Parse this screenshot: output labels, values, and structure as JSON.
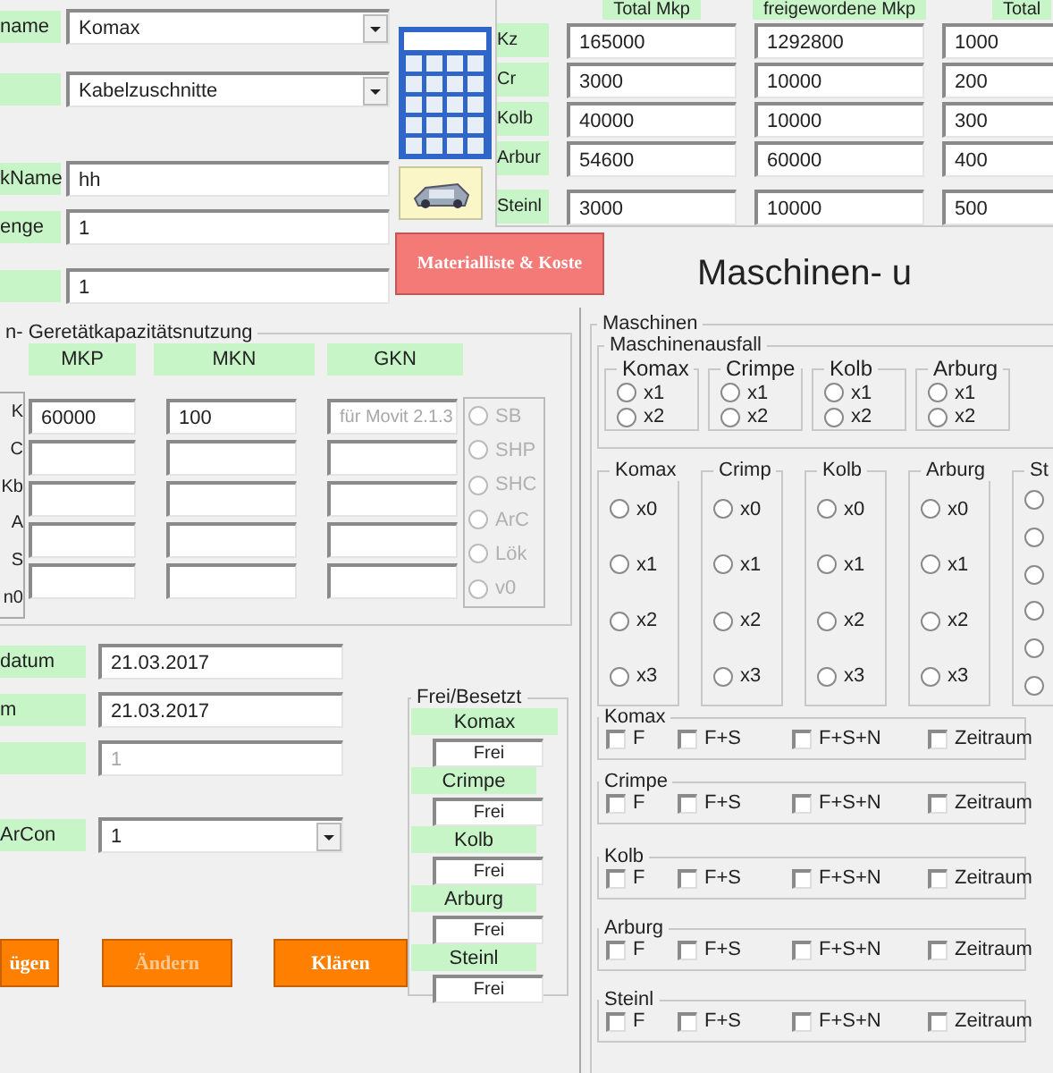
{
  "top_form": [
    {
      "label": "name",
      "kind": "combo",
      "value": "Komax"
    },
    {
      "kind": "combo",
      "value": "Kabelzuschnitte"
    },
    {
      "label": "kName",
      "kind": "text",
      "value": "hh"
    },
    {
      "label": "enge",
      "kind": "text",
      "value": "1"
    },
    {
      "kind": "text",
      "value": "1"
    }
  ],
  "capacity": {
    "headers": [
      "Total Mkp",
      "freigewordene Mkp",
      "Total"
    ],
    "rows": [
      {
        "label": "Kz",
        "values": [
          "165000",
          "1292800",
          "1000"
        ]
      },
      {
        "label": "Cr",
        "values": [
          "3000",
          "10000",
          "200"
        ]
      },
      {
        "label": "Kolb",
        "values": [
          "40000",
          "10000",
          "300"
        ]
      },
      {
        "label": "Arbur",
        "values": [
          "54600",
          "60000",
          "400"
        ]
      },
      {
        "label": "Steinl",
        "values": [
          "3000",
          "10000",
          "500"
        ]
      }
    ]
  },
  "material_button": "Materialliste & Koste",
  "heading": "Maschinen- u",
  "geraet": {
    "title": "n- Geretätkapazitätsnutzung",
    "row_labels": [
      "K",
      "C",
      "Kb",
      "A",
      "S",
      "n0"
    ],
    "columns": [
      {
        "header": "MKP",
        "cells": [
          {
            "kind": "text",
            "value": "60000"
          },
          {
            "kind": "empty"
          },
          {
            "kind": "empty"
          },
          {
            "kind": "empty"
          },
          {
            "kind": "empty"
          }
        ]
      },
      {
        "header": "MKN",
        "cells": [
          {
            "kind": "text",
            "value": "100"
          },
          {
            "kind": "empty"
          },
          {
            "kind": "empty"
          },
          {
            "kind": "empty"
          },
          {
            "kind": "empty"
          }
        ]
      },
      {
        "header": "GKN",
        "cells": [
          {
            "kind": "disabled",
            "value": "für Movit 2.1.3"
          },
          {
            "kind": "empty"
          },
          {
            "kind": "empty"
          },
          {
            "kind": "empty"
          },
          {
            "kind": "empty"
          }
        ]
      }
    ],
    "options": {
      "disabled": true,
      "items": [
        {
          "label": "SB",
          "selected": false
        },
        {
          "label": "SHP",
          "selected": false
        },
        {
          "label": "SHC",
          "selected": false
        },
        {
          "label": "ArC",
          "selected": false
        },
        {
          "label": "Lök",
          "selected": false
        },
        {
          "label": "v0",
          "selected": false
        }
      ]
    }
  },
  "dates": [
    {
      "label": "datum",
      "kind": "text",
      "value": "21.03.2017"
    },
    {
      "label": "m",
      "kind": "text",
      "value": "21.03.2017"
    },
    {
      "kind": "disabled",
      "value": "1"
    },
    {
      "label": "ArCon",
      "kind": "combo",
      "value": "1"
    }
  ],
  "buttons": [
    {
      "label": "ügen",
      "disabled": false
    },
    {
      "label": "Ändern",
      "disabled": true
    },
    {
      "label": "Klären",
      "disabled": false
    }
  ],
  "frei_besetzt": {
    "title": "Frei/Besetzt",
    "items": [
      {
        "label": "Komax",
        "status": "Frei"
      },
      {
        "label": "Crimpe",
        "status": "Frei"
      },
      {
        "label": "Kolb",
        "status": "Frei"
      },
      {
        "label": "Arburg",
        "status": "Frei"
      },
      {
        "label": "Steinl",
        "status": "Frei"
      }
    ]
  },
  "maschinen": {
    "title": "Maschinen",
    "ausfall": {
      "title": "Maschinenausfall",
      "groups": [
        {
          "title": "Komax",
          "options": [
            {
              "label": "x1",
              "selected": false
            },
            {
              "label": "x2",
              "selected": false
            }
          ]
        },
        {
          "title": "Crimpe",
          "options": [
            {
              "label": "x1",
              "selected": false
            },
            {
              "label": "x2",
              "selected": false
            }
          ]
        },
        {
          "title": "Kolb",
          "options": [
            {
              "label": "x1",
              "selected": false
            },
            {
              "label": "x2",
              "selected": false
            }
          ]
        },
        {
          "title": "Arburg",
          "options": [
            {
              "label": "x1",
              "selected": false
            },
            {
              "label": "x2",
              "selected": false
            }
          ]
        }
      ]
    },
    "levels": [
      {
        "title": "Komax",
        "options": [
          {
            "label": "x0",
            "selected": false
          },
          {
            "label": "x1",
            "selected": false
          },
          {
            "label": "x2",
            "selected": false
          },
          {
            "label": "x3",
            "selected": false
          }
        ]
      },
      {
        "title": "Crimp",
        "options": [
          {
            "label": "x0",
            "selected": false
          },
          {
            "label": "x1",
            "selected": false
          },
          {
            "label": "x2",
            "selected": false
          },
          {
            "label": "x3",
            "selected": false
          }
        ]
      },
      {
        "title": "Kolb",
        "options": [
          {
            "label": "x0",
            "selected": false
          },
          {
            "label": "x1",
            "selected": false
          },
          {
            "label": "x2",
            "selected": false
          },
          {
            "label": "x3",
            "selected": false
          }
        ]
      },
      {
        "title": "Arburg",
        "options": [
          {
            "label": "x0",
            "selected": false
          },
          {
            "label": "x1",
            "selected": false
          },
          {
            "label": "x2",
            "selected": false
          },
          {
            "label": "x3",
            "selected": false
          }
        ]
      },
      {
        "title": "St",
        "options": [
          {
            "selected": false
          },
          {
            "selected": false
          },
          {
            "selected": false
          },
          {
            "selected": false
          },
          {
            "selected": false
          },
          {
            "selected": false
          }
        ]
      }
    ],
    "checks": [
      {
        "title": "Komax",
        "options": [
          {
            "label": "F",
            "checked": false
          },
          {
            "label": "F+S",
            "checked": false
          },
          {
            "label": "F+S+N",
            "checked": false
          },
          {
            "label": "Zeitraum",
            "checked": false
          }
        ]
      },
      {
        "title": "Crimpe",
        "options": [
          {
            "label": "F",
            "checked": false
          },
          {
            "label": "F+S",
            "checked": false
          },
          {
            "label": "F+S+N",
            "checked": false
          },
          {
            "label": "Zeitraum",
            "checked": false
          }
        ]
      },
      {
        "title": "Kolb",
        "options": [
          {
            "label": "F",
            "checked": false
          },
          {
            "label": "F+S",
            "checked": false
          },
          {
            "label": "F+S+N",
            "checked": false
          },
          {
            "label": "Zeitraum",
            "checked": false
          }
        ]
      },
      {
        "title": "Arburg",
        "options": [
          {
            "label": "F",
            "checked": false
          },
          {
            "label": "F+S",
            "checked": false
          },
          {
            "label": "F+S+N",
            "checked": false
          },
          {
            "label": "Zeitraum",
            "checked": false
          }
        ]
      },
      {
        "title": "Steinl",
        "options": [
          {
            "label": "F",
            "checked": false
          },
          {
            "label": "F+S",
            "checked": false
          },
          {
            "label": "F+S+N",
            "checked": false
          },
          {
            "label": "Zeitraum",
            "checked": false
          }
        ]
      }
    ]
  }
}
